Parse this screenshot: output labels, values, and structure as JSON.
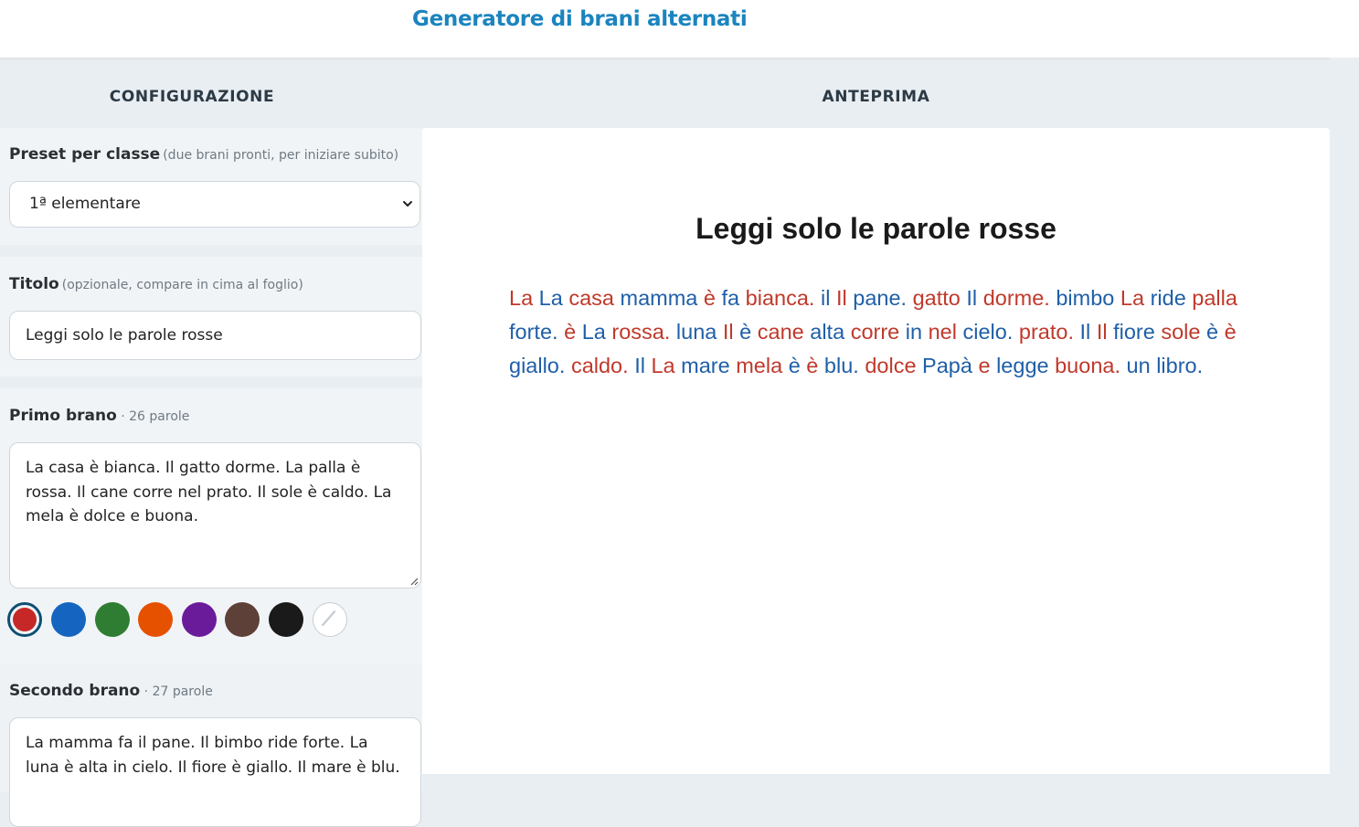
{
  "app": {
    "title": "Generatore di brani alternati"
  },
  "columns": {
    "config": "CONFIGURAZIONE",
    "preview": "ANTEPRIMA"
  },
  "preset": {
    "label": "Preset per classe",
    "hint": "(due brani pronti, per iniziare subito)",
    "selected": "1ª elementare"
  },
  "title_field": {
    "label": "Titolo",
    "hint": "(opzionale, compare in cima al foglio)",
    "value": "Leggi solo le parole rosse"
  },
  "first_text": {
    "label": "Primo brano",
    "count": " · 26 parole",
    "value": "La casa è bianca. Il gatto dorme. La palla è rossa. Il cane corre nel prato. Il sole è caldo. La mela è dolce e buona."
  },
  "colors": {
    "selected": "#c62828",
    "swatches": [
      {
        "name": "red",
        "hex": "#c62828",
        "selected": true
      },
      {
        "name": "blue",
        "hex": "#1565c0",
        "selected": false
      },
      {
        "name": "green",
        "hex": "#2e7d32",
        "selected": false
      },
      {
        "name": "orange",
        "hex": "#e65100",
        "selected": false
      },
      {
        "name": "purple",
        "hex": "#6a1b9a",
        "selected": false
      },
      {
        "name": "brown",
        "hex": "#5d4037",
        "selected": false
      },
      {
        "name": "black",
        "hex": "#1a1a1a",
        "selected": false
      },
      {
        "name": "none",
        "hex": "#ffffff",
        "selected": false
      }
    ]
  },
  "second_text": {
    "label": "Secondo brano",
    "count": " · 27 parole",
    "value": "La mamma fa il pane. Il bimbo ride forte. La luna è alta in cielo. Il fiore è giallo. Il mare è blu."
  },
  "preview": {
    "title": "Leggi solo le parole rosse",
    "red_color": "#c0392b",
    "blue_color": "#1f5fa8",
    "words": [
      {
        "t": "La",
        "c": "r"
      },
      {
        "t": "La",
        "c": "b"
      },
      {
        "t": "casa",
        "c": "r"
      },
      {
        "t": "mamma",
        "c": "b"
      },
      {
        "t": "è",
        "c": "r"
      },
      {
        "t": "fa",
        "c": "b"
      },
      {
        "t": "bianca.",
        "c": "r"
      },
      {
        "t": "il",
        "c": "b"
      },
      {
        "t": "Il",
        "c": "r"
      },
      {
        "t": "pane.",
        "c": "b"
      },
      {
        "t": "gatto",
        "c": "r"
      },
      {
        "t": "Il",
        "c": "b"
      },
      {
        "t": "dorme.",
        "c": "r"
      },
      {
        "t": "bimbo",
        "c": "b"
      },
      {
        "t": "La",
        "c": "r"
      },
      {
        "t": "ride",
        "c": "b"
      },
      {
        "t": "palla",
        "c": "r"
      },
      {
        "t": "forte.",
        "c": "b"
      },
      {
        "t": "è",
        "c": "r"
      },
      {
        "t": "La",
        "c": "b"
      },
      {
        "t": "rossa.",
        "c": "r"
      },
      {
        "t": "luna",
        "c": "b"
      },
      {
        "t": "Il",
        "c": "r"
      },
      {
        "t": "è",
        "c": "b"
      },
      {
        "t": "cane",
        "c": "r"
      },
      {
        "t": "alta",
        "c": "b"
      },
      {
        "t": "corre",
        "c": "r"
      },
      {
        "t": "in",
        "c": "b"
      },
      {
        "t": "nel",
        "c": "r"
      },
      {
        "t": "cielo.",
        "c": "b"
      },
      {
        "t": "prato.",
        "c": "r"
      },
      {
        "t": "Il",
        "c": "b"
      },
      {
        "t": "Il",
        "c": "r"
      },
      {
        "t": "fiore",
        "c": "b"
      },
      {
        "t": "sole",
        "c": "r"
      },
      {
        "t": "è",
        "c": "b"
      },
      {
        "t": "è",
        "c": "r"
      },
      {
        "t": "giallo.",
        "c": "b"
      },
      {
        "t": "caldo.",
        "c": "r"
      },
      {
        "t": "Il",
        "c": "b"
      },
      {
        "t": "La",
        "c": "r"
      },
      {
        "t": "mare",
        "c": "b"
      },
      {
        "t": "mela",
        "c": "r"
      },
      {
        "t": "è",
        "c": "b"
      },
      {
        "t": "è",
        "c": "r"
      },
      {
        "t": "blu.",
        "c": "b"
      },
      {
        "t": "dolce",
        "c": "r"
      },
      {
        "t": "Papà",
        "c": "b"
      },
      {
        "t": "e",
        "c": "r"
      },
      {
        "t": "legge",
        "c": "b"
      },
      {
        "t": "buona.",
        "c": "r"
      },
      {
        "t": "un",
        "c": "b"
      },
      {
        "t": "libro.",
        "c": "b"
      }
    ]
  }
}
